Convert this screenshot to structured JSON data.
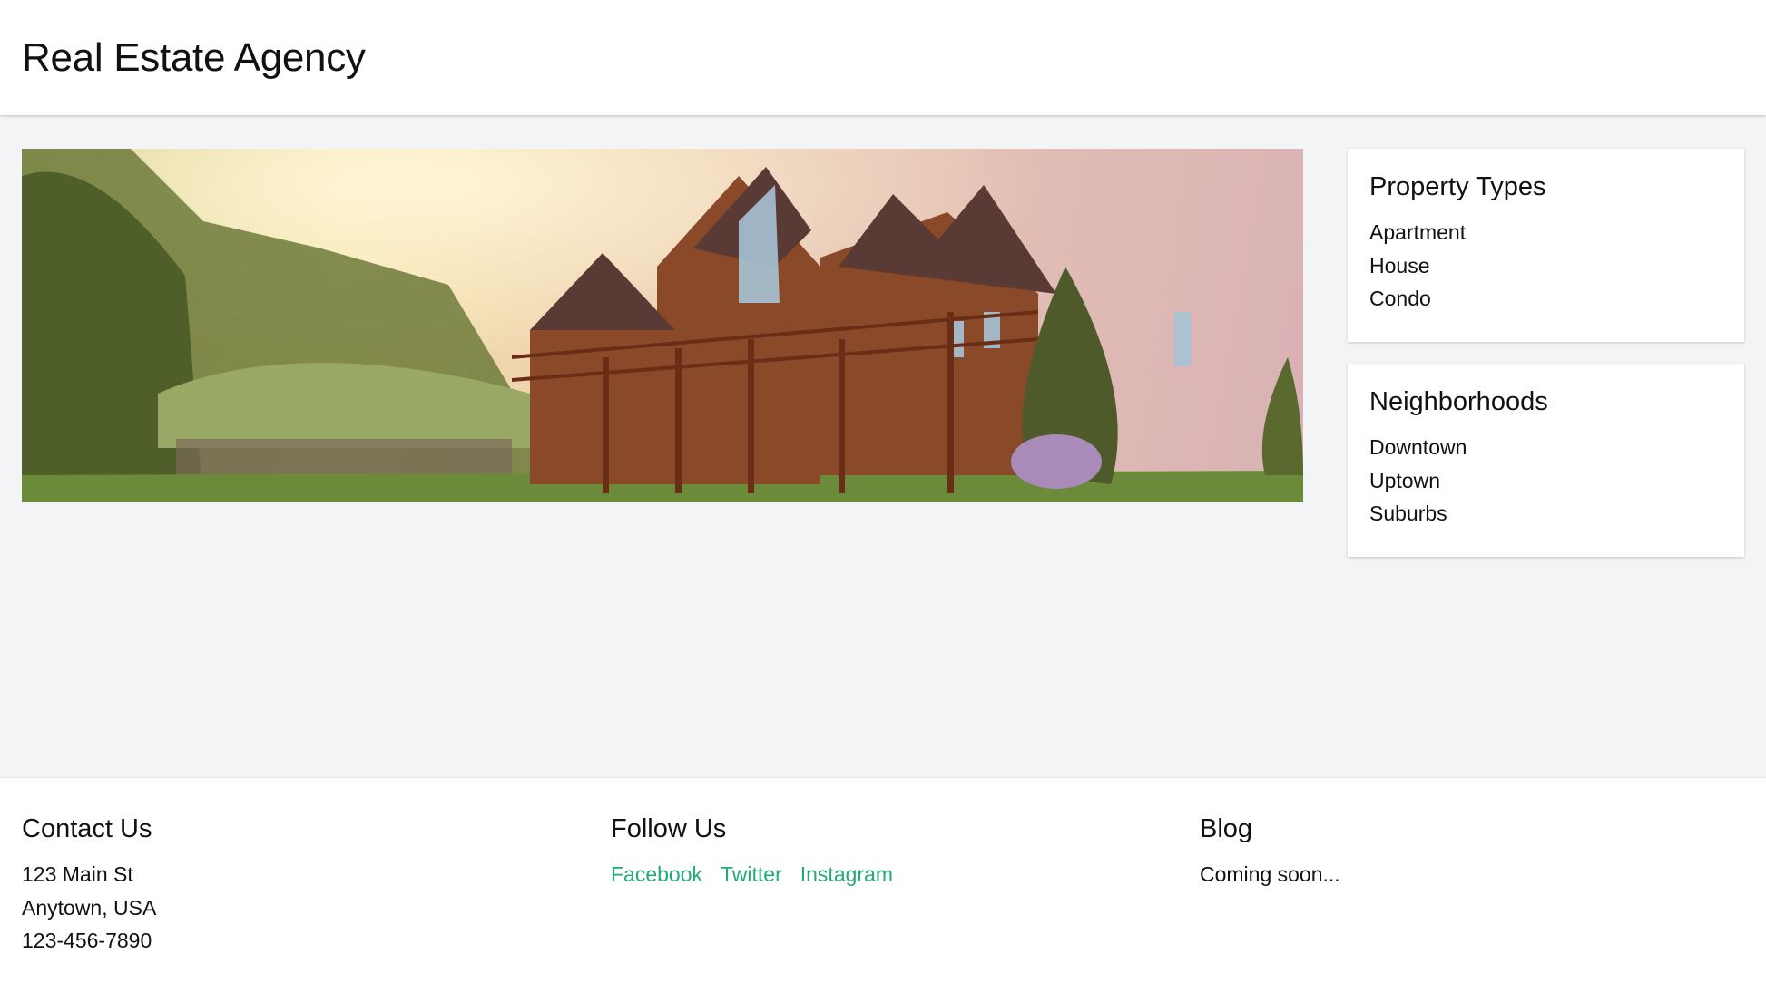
{
  "header": {
    "title": "Real Estate Agency"
  },
  "hero": {
    "image_alt": "Wooden two-story house with large deck at sunset"
  },
  "sidebar": {
    "cards": [
      {
        "title": "Property Types",
        "items": [
          "Apartment",
          "House",
          "Condo"
        ]
      },
      {
        "title": "Neighborhoods",
        "items": [
          "Downtown",
          "Uptown",
          "Suburbs"
        ]
      }
    ]
  },
  "footer": {
    "contact": {
      "title": "Contact Us",
      "lines": [
        "123 Main St",
        "Anytown, USA",
        "123-456-7890"
      ]
    },
    "follow": {
      "title": "Follow Us",
      "links": [
        "Facebook",
        "Twitter",
        "Instagram"
      ]
    },
    "blog": {
      "title": "Blog",
      "text": "Coming soon..."
    }
  },
  "colors": {
    "link": "#26a97a",
    "background": "#f3f4f6",
    "surface": "#ffffff"
  }
}
